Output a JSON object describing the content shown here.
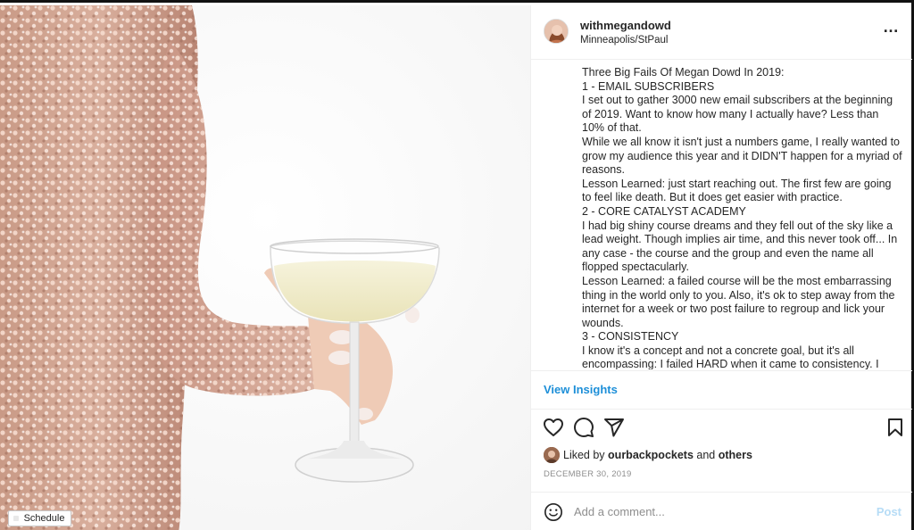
{
  "post": {
    "username": "withmegandowd",
    "location": "Minneapolis/StPaul",
    "more_icon": "…",
    "caption_lines": [
      "Three Big Fails Of Megan Dowd In 2019:",
      "1 - EMAIL SUBSCRIBERS",
      "I set out to gather 3000 new email subscribers at the beginning of 2019. Want to know how many I actually have? Less than 10% of that.",
      "While we all know it isn't just a numbers game, I really wanted to grow my audience this year and it DIDN'T happen for a myriad of reasons.",
      "Lesson Learned: just start reaching out. The first few are going to feel like death. But it does get easier with practice.",
      "2 - CORE CATALYST ACADEMY",
      "I had big shiny course dreams and they fell out of the sky like a lead weight. Though implies air time, and this never took off... In any case - the course and the group and even the name all flopped spectacularly.",
      "Lesson Learned: a failed course will be the most embarrassing thing in the world only to you. Also, it's ok to step away from the internet for a week or two post failure to regroup and lick your wounds.",
      "3 - CONSISTENCY",
      "I know it's a concept and not a concrete goal, but it's all encompassing: I failed HARD when it came to consistency. I"
    ],
    "view_insights": "View Insights",
    "liked_prefix": "Liked by",
    "liked_user": "ourbackpockets",
    "liked_and": "and",
    "liked_others": "others",
    "date": "DECEMBER 30, 2019",
    "comment_placeholder": "Add a comment...",
    "post_label": "Post"
  },
  "photo": {
    "schedule_label": "Schedule"
  },
  "icons": [
    "heart-icon",
    "comment-icon",
    "share-icon",
    "bookmark-icon",
    "emoji-icon"
  ],
  "colors": {
    "link": "#1d8fd8",
    "post_disabled": "#b6dcf6",
    "muted": "#8e8e8e"
  }
}
